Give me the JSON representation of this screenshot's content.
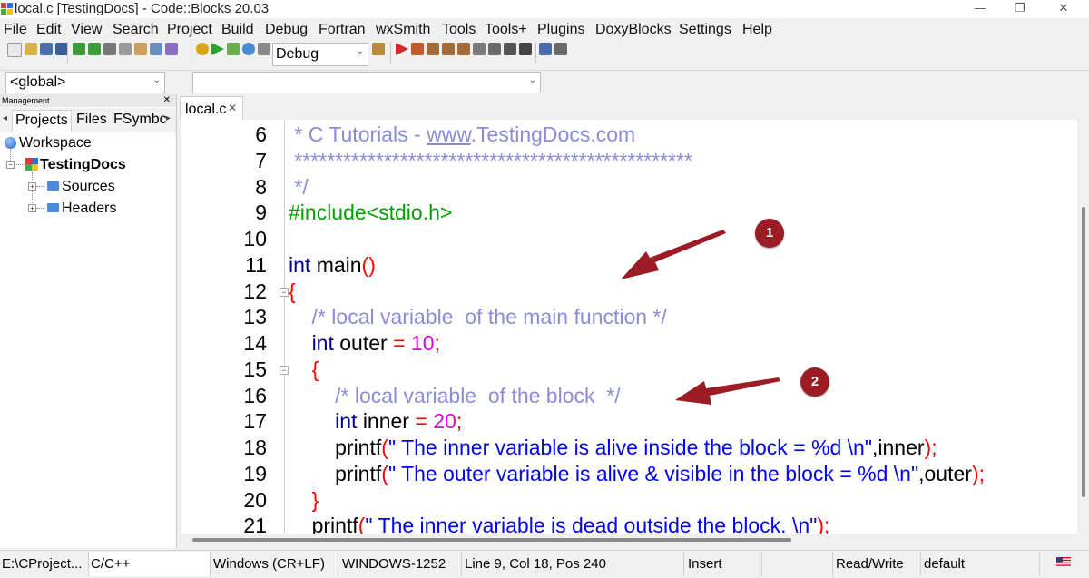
{
  "window": {
    "title": "local.c [TestingDocs] - Code::Blocks 20.03",
    "controls": {
      "minimize": "—",
      "maximize": "❐",
      "close": "✕"
    }
  },
  "menu": [
    "File",
    "Edit",
    "View",
    "Search",
    "Project",
    "Build",
    "Debug",
    "Fortran",
    "wxSmith",
    "Tools",
    "Tools+",
    "Plugins",
    "DoxyBlocks",
    "Settings",
    "Help"
  ],
  "toolbar": {
    "build_target": "Debug",
    "scope": "<global>",
    "function": ""
  },
  "management": {
    "header": "Management",
    "close": "✕",
    "tabs": [
      "Projects",
      "Files",
      "FSymbc"
    ],
    "tree": {
      "workspace": "Workspace",
      "project": "TestingDocs",
      "folders": [
        "Sources",
        "Headers"
      ]
    }
  },
  "editor": {
    "tab": "local.c",
    "tab_close": "✕",
    "lines": [
      {
        "num": "6",
        "code": " * C Tutorials - www.TestingDocs.com"
      },
      {
        "num": "7",
        "code": " *************************************************"
      },
      {
        "num": "8",
        "code": " */"
      },
      {
        "num": "9",
        "code": "#include<stdio.h>"
      },
      {
        "num": "10",
        "code": ""
      },
      {
        "num": "11",
        "code": "int main()"
      },
      {
        "num": "12",
        "code": "{"
      },
      {
        "num": "13",
        "code": "    /* local variable  of the main function */"
      },
      {
        "num": "14",
        "code": "    int outer = 10;"
      },
      {
        "num": "15",
        "code": "    {"
      },
      {
        "num": "16",
        "code": "        /* local variable  of the block  */"
      },
      {
        "num": "17",
        "code": "        int inner = 20;"
      },
      {
        "num": "18",
        "code": "        printf(\" The inner variable is alive inside the block = %d \\n\",inner);"
      },
      {
        "num": "19",
        "code": "        printf(\" The outer variable is alive & visible in the block = %d \\n\",outer);"
      },
      {
        "num": "20",
        "code": "    }"
      },
      {
        "num": "21",
        "code": "    printf(\" The inner variable is dead outside the block. \\n\");"
      }
    ]
  },
  "annotations": [
    "1",
    "2"
  ],
  "statusbar": {
    "path": "E:\\CProject...",
    "language": "C/C++",
    "eol": "Windows (CR+LF)",
    "encoding": "WINDOWS-1252",
    "position": "Line 9, Col 18, Pos 240",
    "mode": "Insert",
    "access": "Read/Write",
    "profile": "default"
  },
  "colors": {
    "comment": "#8a8dd6",
    "keyword": "#00008b",
    "number": "#e000e0",
    "operator": "#ff0000",
    "string": "#0000ff",
    "preprocessor": "#00a000",
    "annotation": "#9b1c24"
  }
}
